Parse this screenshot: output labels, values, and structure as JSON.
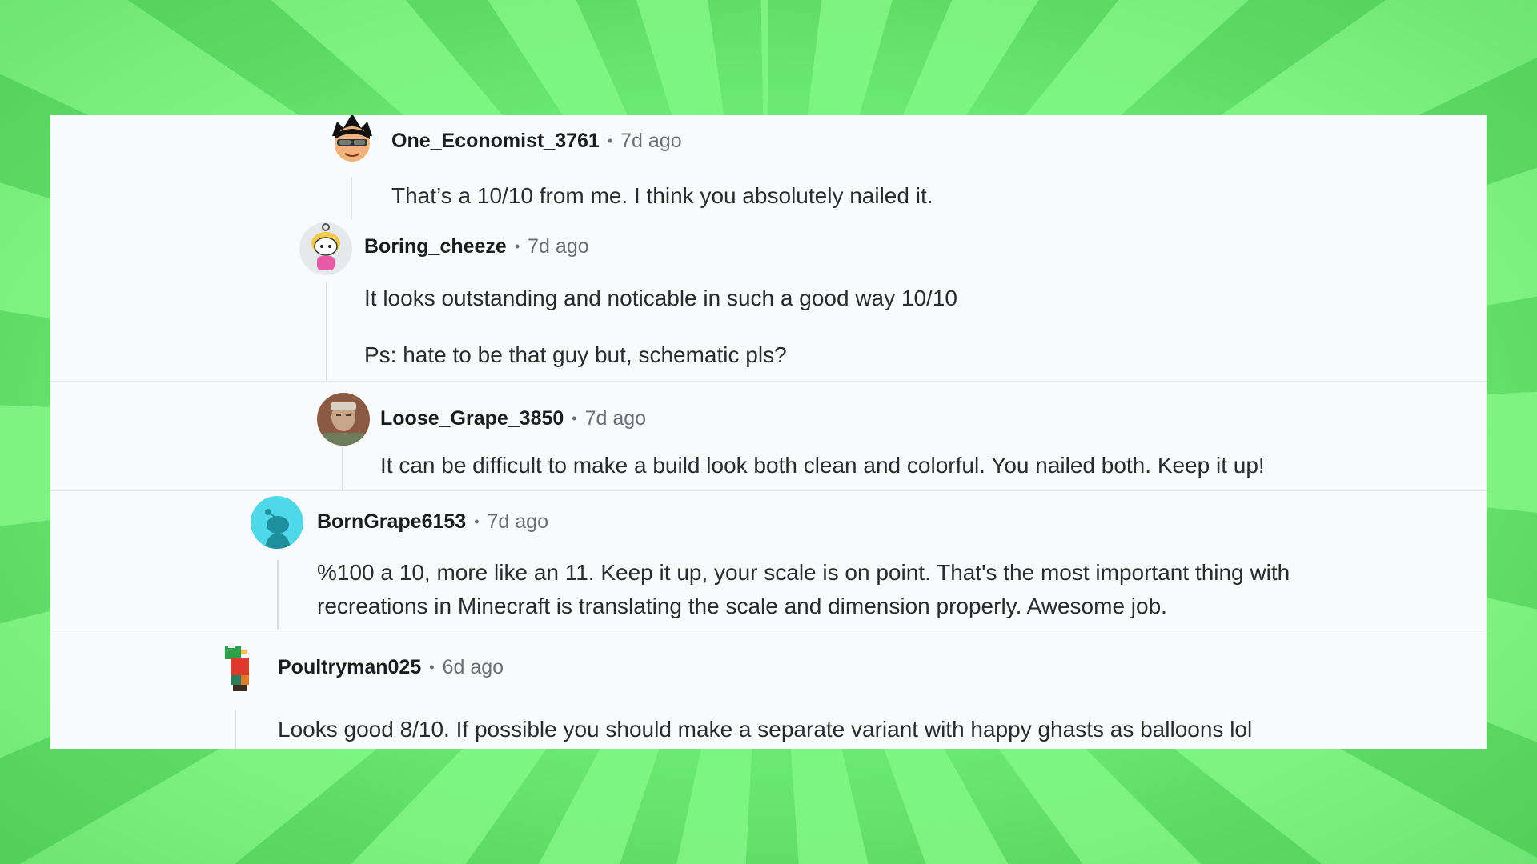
{
  "comments": [
    {
      "username": "One_Economist_3761",
      "separator": "•",
      "time": "7d ago",
      "lines": [
        "That’s a 10/10 from me. I think you absolutely nailed it."
      ],
      "avatar_icon": "cartoon-face-avatar-icon"
    },
    {
      "username": "Boring_cheeze",
      "separator": "•",
      "time": "7d ago",
      "lines": [
        "It looks outstanding and noticable in such a good way 10/10",
        "Ps: hate to be that guy but, schematic pls?"
      ],
      "avatar_icon": "snoo-helmet-avatar-icon"
    },
    {
      "username": "Loose_Grape_3850",
      "separator": "•",
      "time": "7d ago",
      "lines": [
        "It can be difficult to make a build look both clean and colorful. You nailed both. Keep it up!"
      ],
      "avatar_icon": "photo-avatar-icon"
    },
    {
      "username": "BornGrape6153",
      "separator": "•",
      "time": "7d ago",
      "lines": [
        "%100 a 10, more like an 11. Keep it up, your scale is on point. That's the most important thing with",
        "recreations in Minecraft is translating the scale and dimension properly. Awesome job."
      ],
      "avatar_icon": "default-snoo-avatar-icon"
    },
    {
      "username": "Poultryman025",
      "separator": "•",
      "time": "6d ago",
      "lines": [
        "Looks good 8/10. If possible you should make a separate variant with happy ghasts as balloons lol"
      ],
      "avatar_icon": "pixel-parrot-avatar-icon"
    }
  ],
  "colors": {
    "panel": "#f9fafb",
    "username": "#1c1c1e",
    "meta": "#6b6f75",
    "body_text": "#2a2b2e",
    "thread_line": "#d9dce0",
    "background_green": "#7af47d"
  }
}
